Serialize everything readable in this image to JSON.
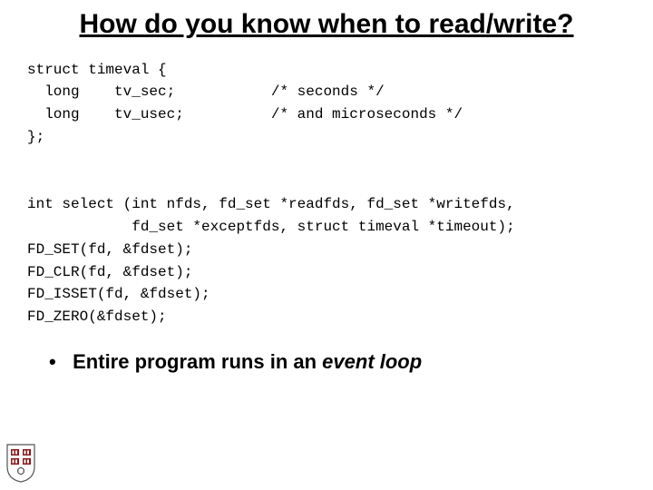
{
  "title": "How do you know when to read/write?",
  "code": {
    "l1": "struct timeval {",
    "l2": "  long    tv_sec;           /* seconds */",
    "l3": "  long    tv_usec;          /* and microseconds */",
    "l4": "};",
    "l5": "",
    "l6": "",
    "l7": "int select (int nfds, fd_set *readfds, fd_set *writefds,",
    "l8": "            fd_set *exceptfds, struct timeval *timeout);",
    "l9": "FD_SET(fd, &fdset);",
    "l10": "FD_CLR(fd, &fdset);",
    "l11": "FD_ISSET(fd, &fdset);",
    "l12": "FD_ZERO(&fdset);"
  },
  "bullet": {
    "prefix": "Entire program runs in an ",
    "emphasis": "event loop"
  },
  "crest_color": "#8a1a1a"
}
